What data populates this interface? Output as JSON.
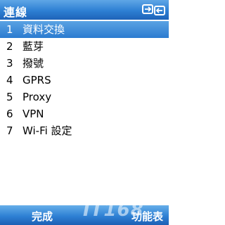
{
  "window": {
    "title": "連線"
  },
  "status_icons": {
    "connection": "connection-icon"
  },
  "menu": {
    "items": [
      {
        "number": "1",
        "label": "資料交換",
        "selected": true
      },
      {
        "number": "2",
        "label": "藍芽",
        "selected": false
      },
      {
        "number": "3",
        "label": "撥號",
        "selected": false
      },
      {
        "number": "4",
        "label": "GPRS",
        "selected": false
      },
      {
        "number": "5",
        "label": "Proxy",
        "selected": false
      },
      {
        "number": "6",
        "label": "VPN",
        "selected": false
      },
      {
        "number": "7",
        "label": "Wi-Fi 設定",
        "selected": false
      }
    ]
  },
  "softkeys": {
    "left_label": "完成",
    "right_label": "功能表"
  },
  "watermark": {
    "text": "IT168"
  },
  "colors": {
    "accent": "#2d7fd3",
    "highlight": "#3c8ad8",
    "text": "#000000",
    "text_on_accent": "#ffffff"
  }
}
